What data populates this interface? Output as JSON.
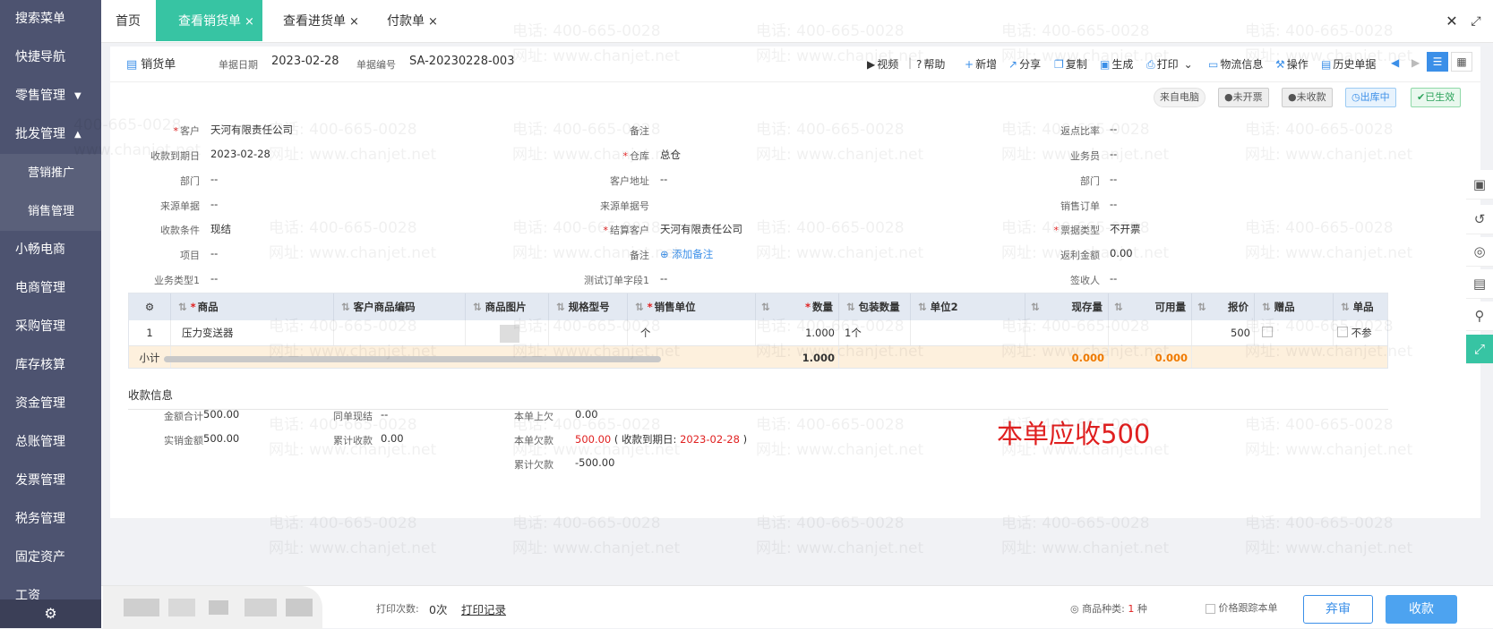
{
  "sidebar": {
    "items": [
      {
        "label": "搜索菜单"
      },
      {
        "label": "快捷导航"
      },
      {
        "label": "零售管理",
        "caret": "▼"
      },
      {
        "label": "批发管理",
        "caret": "▲"
      },
      {
        "label": "营销推广"
      },
      {
        "label": "销售管理"
      },
      {
        "label": "小畅电商"
      },
      {
        "label": "电商管理"
      },
      {
        "label": "采购管理"
      },
      {
        "label": "库存核算"
      },
      {
        "label": "资金管理"
      },
      {
        "label": "总账管理"
      },
      {
        "label": "发票管理"
      },
      {
        "label": "税务管理"
      },
      {
        "label": "固定资产"
      },
      {
        "label": "工资"
      }
    ]
  },
  "tabs": {
    "home": "首页",
    "sales_view": "查看销货单",
    "purchase_view": "查看进货单",
    "payment": "付款单",
    "close_glyph": "×"
  },
  "window": {
    "close": "✕",
    "maximize": "⤢"
  },
  "toolbar": {
    "doc_type": "销货单",
    "date_label": "单据日期",
    "date_value": "2023-02-28",
    "no_label": "单据编号",
    "no_value": "SA-20230228-003",
    "video": "视频",
    "help": "帮助",
    "new": "新增",
    "share": "分享",
    "copy": "复制",
    "generate": "生成",
    "print": "打印",
    "logistics": "物流信息",
    "operate": "操作",
    "history": "历史单据"
  },
  "badges": {
    "source": "来自电脑",
    "not_invoiced": "未开票",
    "not_collected": "未收款",
    "out_stock": "出库中",
    "effective": "已生效"
  },
  "form": {
    "customer_label": "客户",
    "customer_value": "天河有限责任公司",
    "remark_label": "备注",
    "rebate_ratio_label": "返点比率",
    "rebate_ratio_value": "--",
    "due_date_label": "收款到期日",
    "due_date_value": "2023-02-28",
    "warehouse_label": "仓库",
    "warehouse_value": "总仓",
    "salesman_label": "业务员",
    "salesman_value": "--",
    "dept_label": "部门",
    "dept_value": "--",
    "cust_addr_label": "客户地址",
    "cust_addr_value": "--",
    "dept2_label": "部门",
    "dept2_value": "--",
    "source_doc_label": "来源单据",
    "source_doc_value": "--",
    "source_no_label": "来源单据号",
    "sales_order_label": "销售订单",
    "sales_order_value": "--",
    "pay_terms_label": "收款条件",
    "pay_terms_value": "现结",
    "settle_cust_label": "结算客户",
    "settle_cust_value": "天河有限责任公司",
    "invoice_type_label": "票据类型",
    "invoice_type_value": "不开票",
    "project_label": "项目",
    "project_value": "--",
    "remark2_label": "备注",
    "add_remark": "添加备注",
    "rebate_amount_label": "返利金额",
    "rebate_amount_value": "0.00",
    "biz_type_label": "业务类型1",
    "biz_type_value": "--",
    "test_field_label": "测试订单字段1",
    "test_field_value": "--",
    "signer_label": "签收人",
    "signer_value": "--"
  },
  "grid": {
    "columns": [
      "商品",
      "客户商品编码",
      "商品图片",
      "规格型号",
      "销售单位",
      "数量",
      "包装数量",
      "单位2",
      "现存量",
      "可用量",
      "报价",
      "赠品",
      "单品"
    ],
    "rows": [
      {
        "index": "1",
        "product": "压力变送器",
        "unit": "个",
        "qty": "1.000",
        "pack_qty": "1个",
        "price": "500",
        "tail": "不参"
      }
    ],
    "subtotal_label": "小计",
    "subtotal_qty": "1.000",
    "subtotal_stock": "0.000",
    "subtotal_available": "0.000"
  },
  "payment_info": {
    "title": "收款信息",
    "total_label": "金额合计",
    "total_value": "500.00",
    "same_cash_label": "同单现结",
    "same_cash_value": "--",
    "prev_owed_label": "本单上欠",
    "prev_owed_value": "0.00",
    "actual_label": "实销金额",
    "actual_value": "500.00",
    "cum_collect_label": "累计收款",
    "cum_collect_value": "0.00",
    "owed_label": "本单欠款",
    "owed_value": "500.00",
    "owed_due_prefix": "( 收款到期日:",
    "owed_due_date": "2023-02-28",
    "owed_due_suffix": ")",
    "cum_owed_label": "累计欠款",
    "cum_owed_value": "-500.00",
    "annotation": "本单应收500"
  },
  "footer": {
    "print_count_label": "打印次数:",
    "print_count_value": "0次",
    "print_record": "打印记录",
    "kinds_label": "商品种类:",
    "kinds_value": "1",
    "kinds_unit": "种",
    "price_track": "价格跟踪本单",
    "discard": "弃审",
    "collect": "收款"
  },
  "watermark": {
    "phone": "电话: 400-665-0028",
    "site": "网址: www.chanjet.net",
    "phone_short": "400-665-0028",
    "site_short": "www.chanjet.net"
  },
  "colors": {
    "sidebar": "#4d5370",
    "active_tab": "#37c4a3",
    "accent": "#3b8fe8",
    "danger": "#e02020",
    "orange": "#f07a00",
    "subtotal_bg": "#fdf0dd"
  }
}
